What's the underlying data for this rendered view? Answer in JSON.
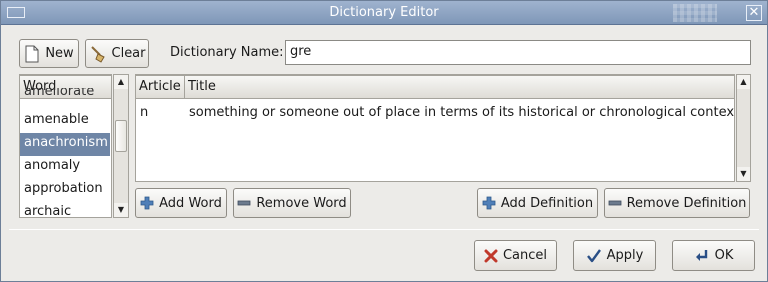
{
  "window": {
    "title": "Dictionary Editor"
  },
  "toolbar": {
    "new_label": "New",
    "clear_label": "Clear",
    "dict_name_label": "Dictionary Name:",
    "dict_name_value": "gre"
  },
  "word_list": {
    "header": "Word",
    "partial_top": "ameliorate",
    "items": [
      "amenable",
      "anachronism",
      "anomaly",
      "approbation",
      "archaic"
    ],
    "selected": "anachronism"
  },
  "definitions": {
    "columns": [
      "Article",
      "Title"
    ],
    "rows": [
      {
        "article": "n",
        "title": "something or someone out of place in terms of its historical or chronological context"
      }
    ]
  },
  "actions": {
    "add_word": "Add Word",
    "remove_word": "Remove Word",
    "add_definition": "Add Definition",
    "remove_definition": "Remove Definition"
  },
  "dialog_buttons": {
    "cancel": "Cancel",
    "apply": "Apply",
    "ok": "OK"
  },
  "colors": {
    "titlebar": "#8fa5c4",
    "selection": "#6f86a6",
    "cancel_icon": "#c0392b",
    "add_icon": "#3a6ea5"
  }
}
